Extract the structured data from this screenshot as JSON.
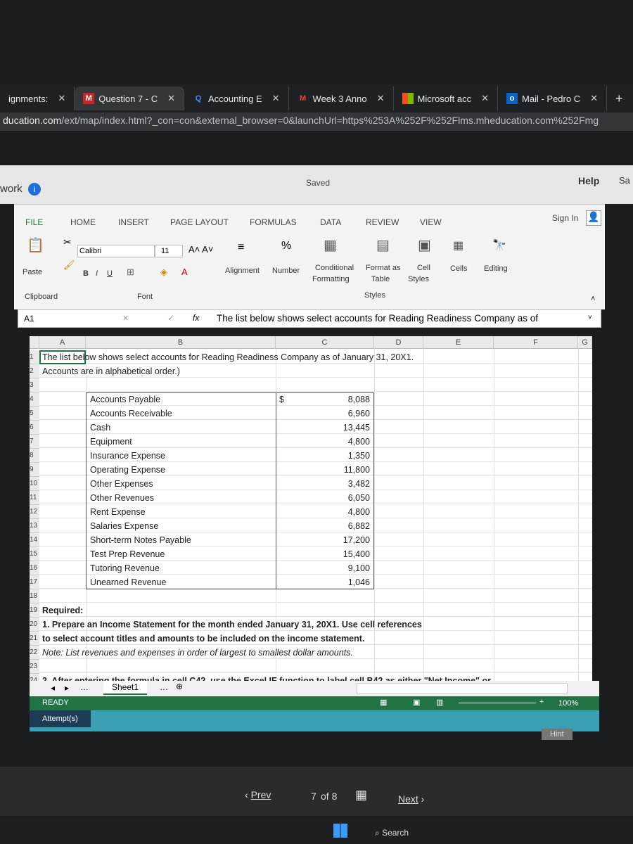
{
  "browser": {
    "tabs": [
      {
        "label": "ignments:",
        "icon": "assignments-icon"
      },
      {
        "label": "Question 7 - C",
        "icon": "mcgraw-hill-icon",
        "active": true
      },
      {
        "label": "Accounting E",
        "icon": "search-q-icon"
      },
      {
        "label": "Week 3 Anno",
        "icon": "gmail-icon"
      },
      {
        "label": "Microsoft acc",
        "icon": "microsoft-icon"
      },
      {
        "label": "Mail - Pedro C",
        "icon": "outlook-icon"
      }
    ],
    "url_domain": "ducation.com",
    "url_path": "/ext/map/index.html?_con=con&external_browser=0&launchUrl=https%253A%252F%252Flms.mheducation.com%252Fmg"
  },
  "app": {
    "work_label": "work",
    "saved": "Saved",
    "help": "Help",
    "sa": "Sa",
    "sign_in": "Sign In"
  },
  "ribbon": {
    "tabs": [
      "FILE",
      "HOME",
      "INSERT",
      "PAGE LAYOUT",
      "FORMULAS",
      "DATA",
      "REVIEW",
      "VIEW"
    ],
    "paste": "Paste",
    "clipboard": "Clipboard",
    "font_name": "Calibri",
    "font_size": "11",
    "bold": "B",
    "italic": "I",
    "underline": "U",
    "font": "Font",
    "alignment": "Alignment",
    "number": "Number",
    "conditional": "Conditional",
    "formatting": "Formatting",
    "format_as": "Format as",
    "table": "Table",
    "cell": "Cell",
    "styles_btn": "Styles",
    "styles": "Styles",
    "cells": "Cells",
    "editing": "Editing"
  },
  "formula_bar": {
    "name_box": "A1",
    "fx": "fx",
    "content": "The list below shows select accounts for Reading Readiness Company as of"
  },
  "sheet": {
    "columns": [
      "A",
      "B",
      "C",
      "D",
      "E",
      "F",
      "G"
    ],
    "row1": "The list below shows select accounts for Reading Readiness Company as of January 31, 20X1.",
    "row2": "Accounts are in alphabetical order.)",
    "currency": "$",
    "accounts": [
      {
        "name": "Accounts Payable",
        "amount": "8,088"
      },
      {
        "name": "Accounts Receivable",
        "amount": "6,960"
      },
      {
        "name": "Cash",
        "amount": "13,445"
      },
      {
        "name": "Equipment",
        "amount": "4,800"
      },
      {
        "name": "Insurance Expense",
        "amount": "1,350"
      },
      {
        "name": "Operating Expense",
        "amount": "11,800"
      },
      {
        "name": "Other Expenses",
        "amount": "3,482"
      },
      {
        "name": "Other Revenues",
        "amount": "6,050"
      },
      {
        "name": "Rent Expense",
        "amount": "4,800"
      },
      {
        "name": "Salaries Expense",
        "amount": "6,882"
      },
      {
        "name": "Short-term Notes Payable",
        "amount": "17,200"
      },
      {
        "name": "Test Prep Revenue",
        "amount": "15,400"
      },
      {
        "name": "Tutoring Revenue",
        "amount": "9,100"
      },
      {
        "name": "Unearned Revenue",
        "amount": "1,046"
      }
    ],
    "row19": "Required:",
    "row20": "1. Prepare an Income Statement for the month ended January 31, 20X1.  Use cell references",
    "row21": "to select account titles and amounts to be included on the income statement.",
    "row22": "Note:  List revenues and expenses in order of largest to smallest dollar amounts.",
    "row24": "2. After entering the formula in cell C42, use the Excel IF function to label cell B42 as either \"Net Income\" or",
    "sheet_tab": "Sheet1"
  },
  "status": {
    "ready": "READY",
    "zoom": "100%",
    "attempts": "Attempt(s)",
    "hint": "Hint"
  },
  "nav": {
    "prev": "Prev",
    "page": "7",
    "of": "of 8",
    "next": "Next"
  },
  "taskbar": {
    "search": "Search"
  }
}
